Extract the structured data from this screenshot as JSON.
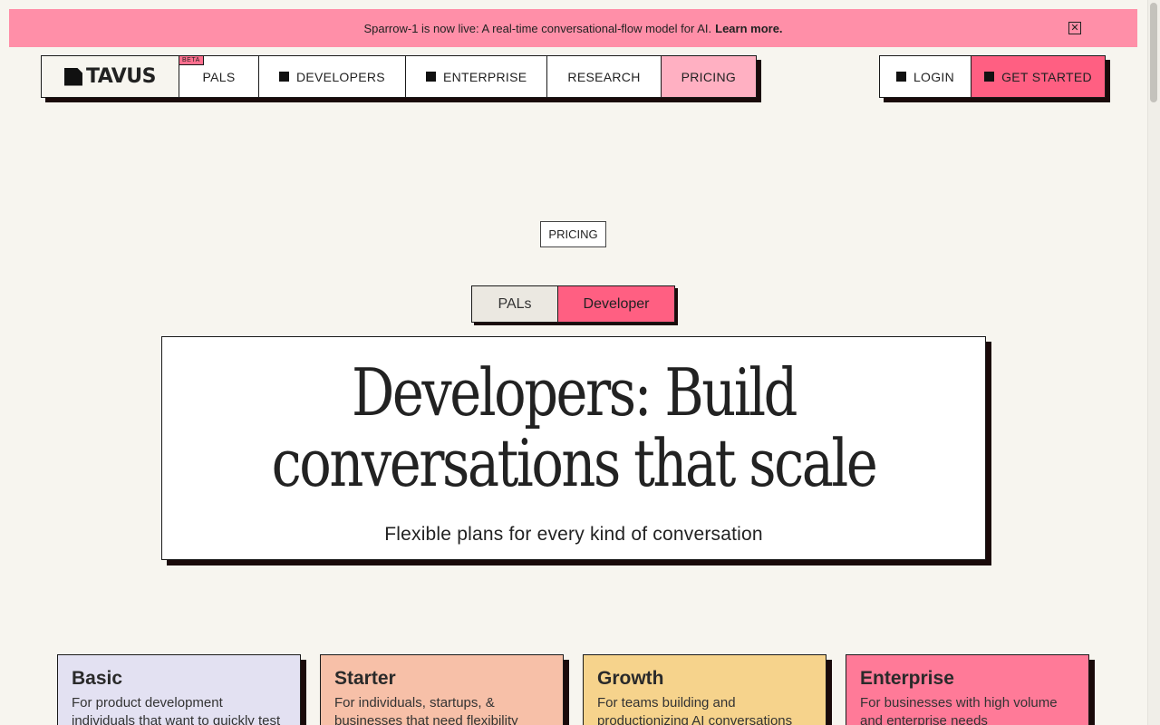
{
  "announcement": {
    "text": "Sparrow-1 is now live: A real-time conversational-flow model for AI.",
    "link": "Learn more.",
    "close_icon": "close-icon"
  },
  "nav": {
    "logo": "TAVUS",
    "beta": "BETA",
    "items": [
      {
        "label": "PALS"
      },
      {
        "label": "DEVELOPERS"
      },
      {
        "label": "ENTERPRISE"
      },
      {
        "label": "RESEARCH"
      },
      {
        "label": "PRICING"
      }
    ],
    "login": "LOGIN",
    "get_started": "GET STARTED"
  },
  "pricing_tag": "PRICING",
  "toggle": {
    "pals": "PALs",
    "developer": "Developer",
    "selected": "Developer"
  },
  "hero": {
    "title_line1": "Developers: Build",
    "title_line2": "conversations that scale",
    "subtitle": "Flexible plans for every kind of conversation"
  },
  "plans": [
    {
      "name": "Basic",
      "description": "For product development individuals that want to quickly test",
      "color": "#e3e1f2"
    },
    {
      "name": "Starter",
      "description": "For individuals, startups, & businesses that need flexibility",
      "color": "#f7c0a8"
    },
    {
      "name": "Growth",
      "description": "For teams building and productionizing AI conversations",
      "color": "#f6d38c"
    },
    {
      "name": "Enterprise",
      "description": "For businesses with high volume and enterprise needs",
      "color": "#ff7a98"
    }
  ],
  "colors": {
    "accent": "#ff5f82",
    "announce_bg": "#ff8fa8",
    "page_bg": "#f7f5ef"
  }
}
